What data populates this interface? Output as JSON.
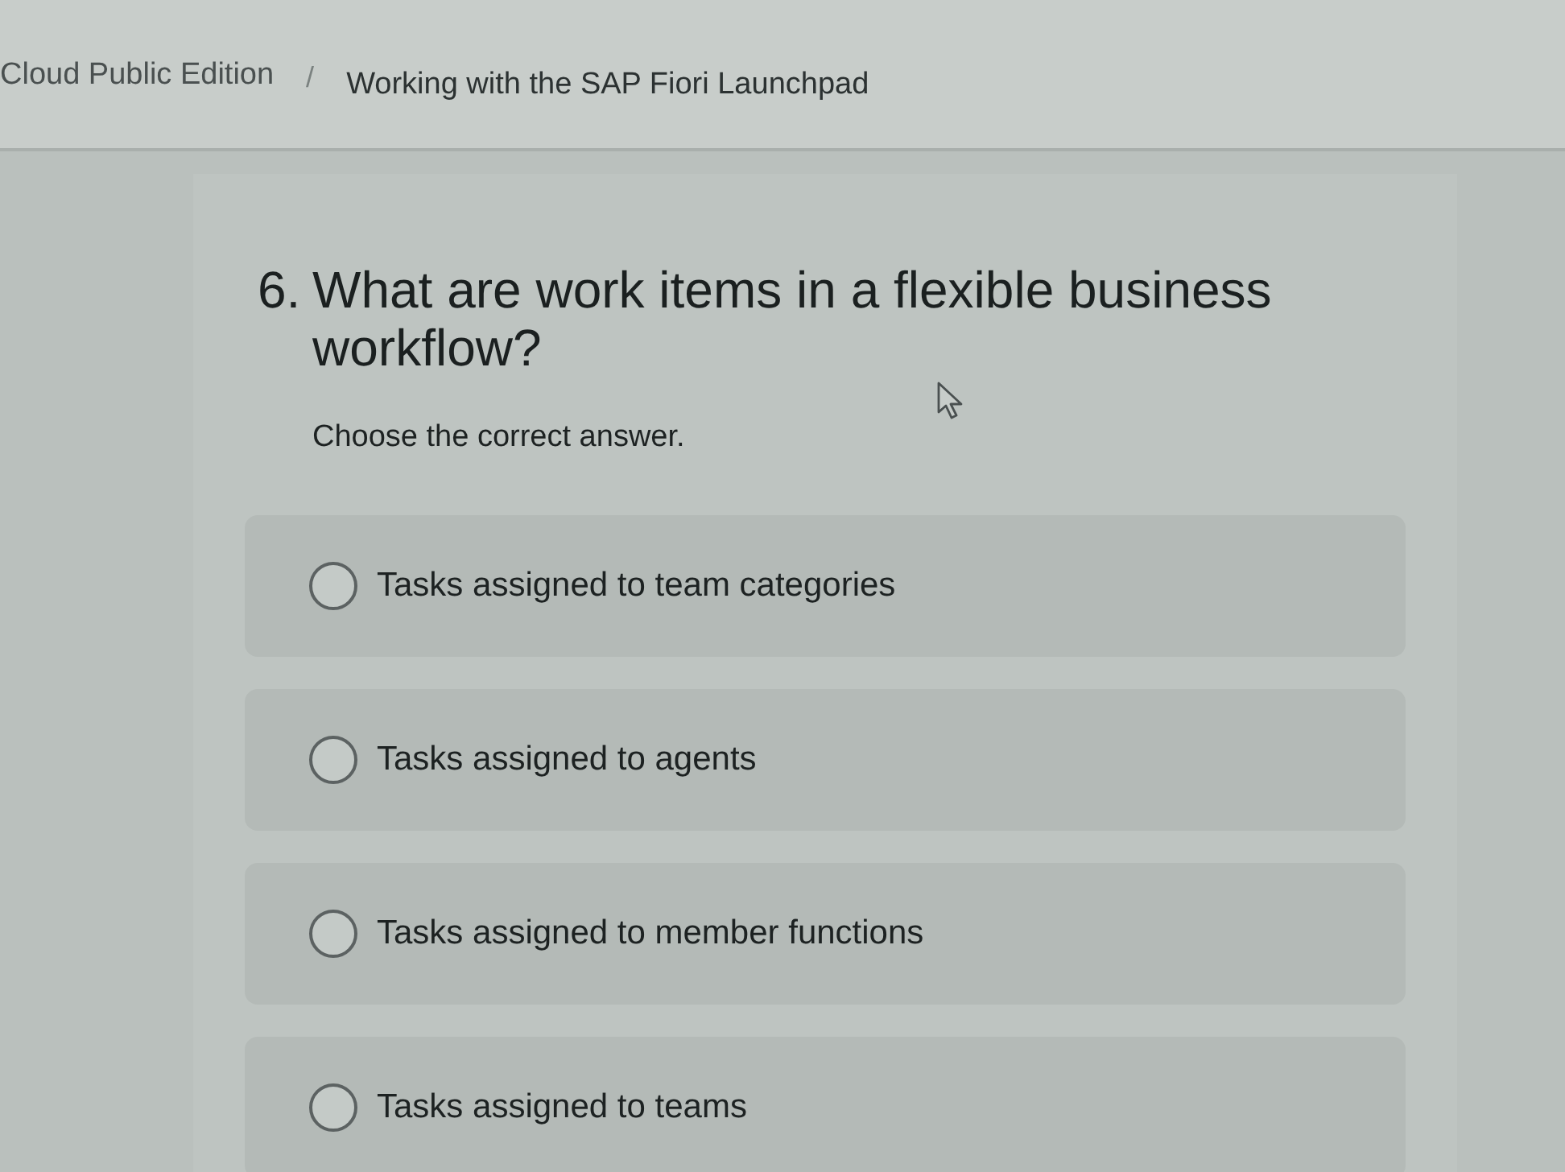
{
  "breadcrumb": {
    "items": [
      {
        "label": "Cloud Public Edition"
      },
      {
        "label": "Working with the SAP Fiori Launchpad"
      }
    ],
    "separator": "/"
  },
  "question": {
    "number": "6.",
    "text": "What are work items in a flexible business workflow?",
    "instruction": "Choose the correct answer."
  },
  "options": [
    {
      "label": "Tasks assigned to team categories",
      "selected": false
    },
    {
      "label": "Tasks assigned to agents",
      "selected": false
    },
    {
      "label": "Tasks assigned to member functions",
      "selected": false
    },
    {
      "label": "Tasks assigned to teams",
      "selected": false
    }
  ]
}
